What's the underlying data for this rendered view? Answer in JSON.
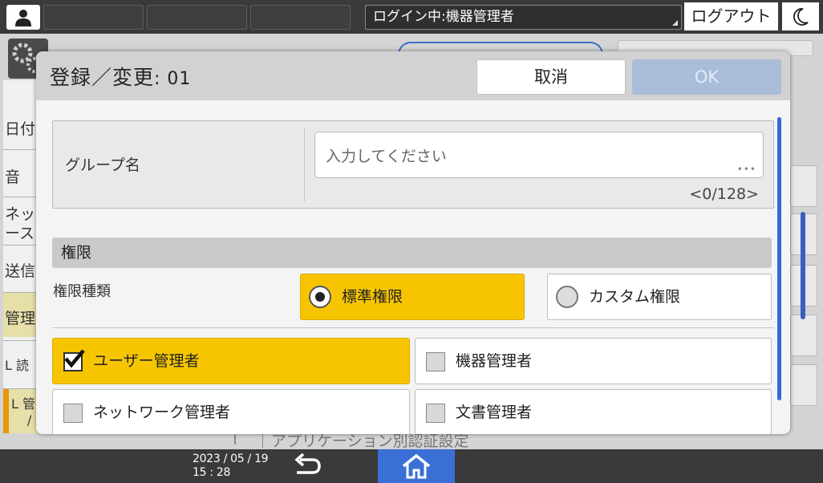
{
  "topbar": {
    "login_status": "ログイン中:機器管理者",
    "logout_label": "ログアウト"
  },
  "background": {
    "side_items": [
      "日付",
      "音",
      "ネッ",
      "ース",
      "送信",
      "管理",
      "L 読",
      "L 管",
      "/"
    ],
    "bottom_text": "アプリケーション別認証設定"
  },
  "dialog": {
    "title": "登録／変更",
    "title_number": ": 01",
    "cancel_label": "取消",
    "ok_label": "OK",
    "group_name": {
      "label": "グループ名",
      "value": "",
      "placeholder": "入力してください",
      "counter": "<0/128>"
    },
    "permissions": {
      "header": "権限",
      "type_label": "権限種類",
      "types": [
        {
          "label": "標準権限",
          "selected": true
        },
        {
          "label": "カスタム権限",
          "selected": false
        }
      ],
      "roles": [
        {
          "label": "ユーザー管理者",
          "checked": true
        },
        {
          "label": "機器管理者",
          "checked": false
        },
        {
          "label": "ネットワーク管理者",
          "checked": false
        },
        {
          "label": "文書管理者",
          "checked": false
        }
      ]
    }
  },
  "footer": {
    "date": "2023 / 05 / 19",
    "time": "15 : 28"
  },
  "colors": {
    "accent_yellow": "#f7c500",
    "accent_blue": "#3a6fd6",
    "ok_disabled": "#a9bcd8"
  },
  "icons": [
    "user-icon",
    "moon-icon",
    "gear-icon",
    "back-arrow-icon",
    "home-icon",
    "checkmark-icon"
  ]
}
